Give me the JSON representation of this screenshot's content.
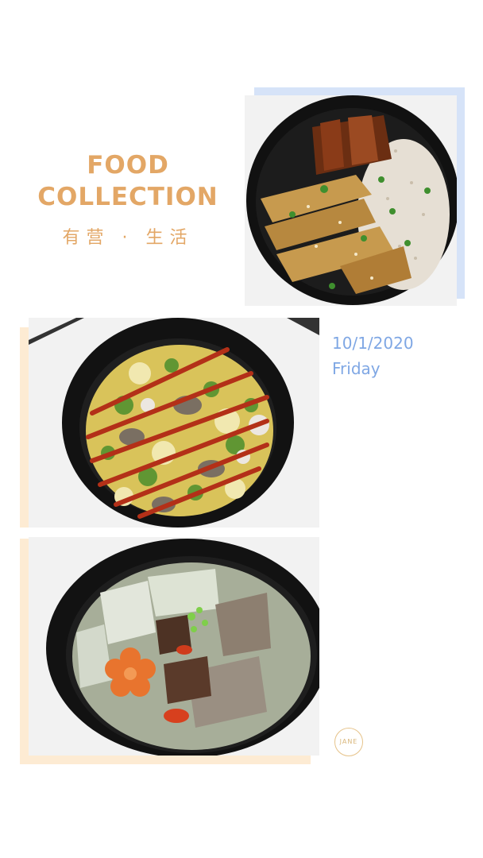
{
  "title": {
    "line1": "FOOD",
    "line2": "COLLECTION"
  },
  "subtitle": "有营 · 生活",
  "date": "10/1/2020",
  "day": "Friday",
  "logo": "JANE",
  "colors": {
    "title": "#e3a766",
    "date": "#7fa7e4",
    "blue_frame": "#d6e3f8",
    "peach_frame": "#fdebd3"
  },
  "photos": [
    {
      "name": "braised-pork-rice-bowl"
    },
    {
      "name": "oyster-omelette-rice-bowl"
    },
    {
      "name": "radish-rib-soup-bowl"
    }
  ]
}
